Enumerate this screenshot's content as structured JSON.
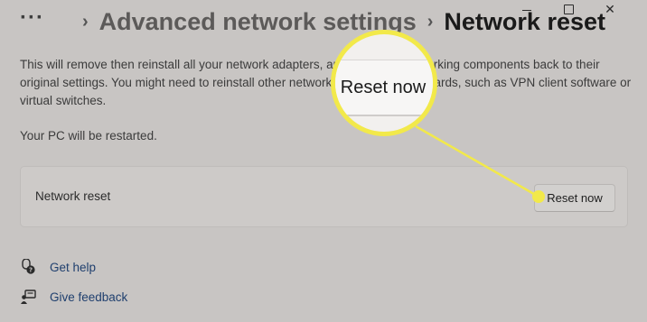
{
  "breadcrumb": {
    "more": "···",
    "separator": "›",
    "parent": "Advanced network settings",
    "current": "Network reset"
  },
  "window_controls": {
    "icons": [
      "minimize-icon",
      "maximize-icon",
      "close-icon"
    ]
  },
  "description": "This will remove then reinstall all your network adapters, and set other networking components back to their original settings. You might need to reinstall other networking software afterwards, such as VPN client software or virtual switches.",
  "restart_note": "Your PC will be restarted.",
  "reset_card": {
    "label": "Network reset",
    "button_label": "Reset now"
  },
  "callout": {
    "zoom_label": "Reset now",
    "color": "#f2e94a"
  },
  "links": {
    "help": {
      "label": "Get help",
      "icon": "help-icon"
    },
    "feedback": {
      "label": "Give feedback",
      "icon": "feedback-icon"
    }
  },
  "colors": {
    "background": "#c8c5c3",
    "link": "#1f3f6e",
    "highlight": "#f2e94a"
  }
}
